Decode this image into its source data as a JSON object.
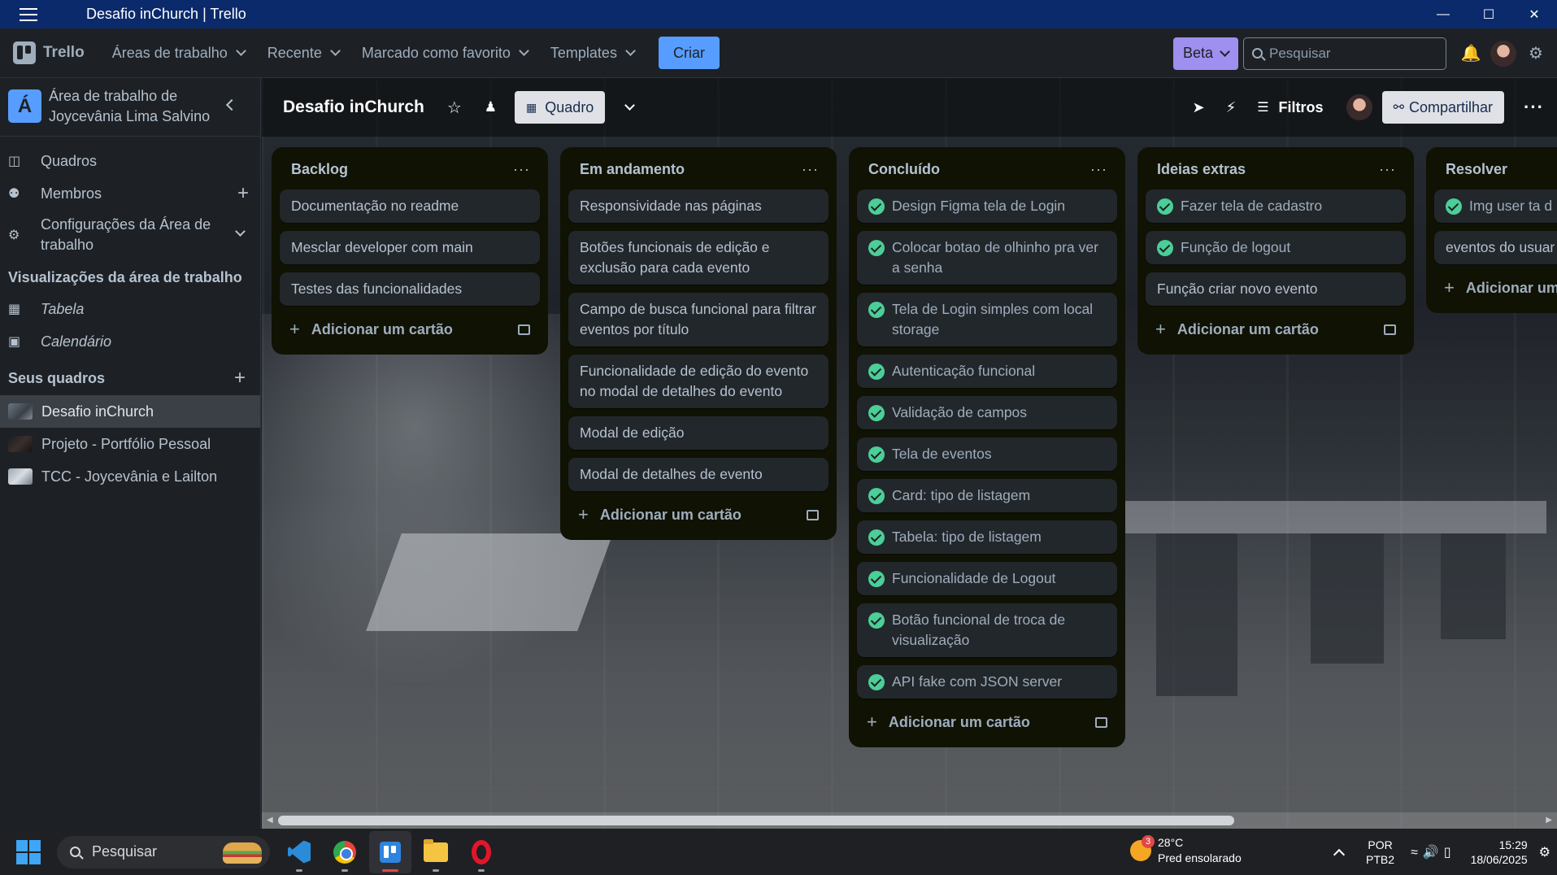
{
  "window": {
    "title": "Desafio inChurch | Trello",
    "controls": [
      "—",
      "☐",
      "✕"
    ]
  },
  "header": {
    "logo_text": "Trello",
    "nav": [
      {
        "label": "Áreas de trabalho"
      },
      {
        "label": "Recente"
      },
      {
        "label": "Marcado como favorito"
      },
      {
        "label": "Templates"
      }
    ],
    "create_label": "Criar",
    "beta_label": "Beta",
    "search_placeholder": "Pesquisar",
    "accent_color": "#579dff",
    "beta_color": "#9f8fef"
  },
  "sidebar": {
    "workspace_initial": "Á",
    "workspace_name_line1": "Área de trabalho de",
    "workspace_name_line2": "Joycevânia Lima Salvino",
    "items": [
      {
        "label": "Quadros",
        "icon": "board-icon"
      },
      {
        "label": "Membros",
        "icon": "person-icon"
      },
      {
        "label_line1": "Configurações da Área de",
        "label_line2": "trabalho",
        "icon": "gear-icon"
      }
    ],
    "views_heading": "Visualizações da área de trabalho",
    "views": [
      {
        "label": "Tabela",
        "icon": "table-icon"
      },
      {
        "label": "Calendário",
        "icon": "calendar-icon"
      }
    ],
    "boards_heading": "Seus quadros",
    "boards": [
      {
        "label": "Desafio inChurch",
        "active": true
      },
      {
        "label": "Projeto - Portfólio Pessoal",
        "active": false
      },
      {
        "label": "TCC - Joycevânia e Lailton",
        "active": false
      }
    ]
  },
  "board": {
    "title": "Desafio inChurch",
    "view_label": "Quadro",
    "filters_label": "Filtros",
    "share_label": "Compartilhar",
    "add_card_label": "Adicionar um cartão",
    "add_card_label_partial": "Adicionar um",
    "lists": [
      {
        "title": "Backlog",
        "cards": [
          {
            "text": "Documentação no readme",
            "done": false
          },
          {
            "text": "Mesclar developer com main",
            "done": false
          },
          {
            "text": "Testes das funcionalidades",
            "done": false
          }
        ]
      },
      {
        "title": "Em andamento",
        "cards": [
          {
            "text": "Responsividade nas páginas",
            "done": false
          },
          {
            "text": "Botões funcionais de edição e exclusão para cada evento",
            "done": false
          },
          {
            "text": "Campo de busca funcional para filtrar eventos por título",
            "done": false
          },
          {
            "text": "Funcionalidade de edição do evento no modal de detalhes do evento",
            "done": false
          },
          {
            "text": "Modal de edição",
            "done": false
          },
          {
            "text": "Modal de detalhes de evento",
            "done": false
          }
        ]
      },
      {
        "title": "Concluído",
        "cards": [
          {
            "text": "Design Figma tela de Login",
            "done": true
          },
          {
            "text": "Colocar botao de olhinho pra ver a senha",
            "done": true
          },
          {
            "text": "Tela de Login simples com local storage",
            "done": true
          },
          {
            "text": "Autenticação funcional",
            "done": true
          },
          {
            "text": "Validação de campos",
            "done": true
          },
          {
            "text": "Tela de eventos",
            "done": true
          },
          {
            "text": "Card: tipo de listagem",
            "done": true
          },
          {
            "text": "Tabela: tipo de listagem",
            "done": true
          },
          {
            "text": "Funcionalidade de Logout",
            "done": true
          },
          {
            "text": "Botão funcional de troca de visualização",
            "done": true
          },
          {
            "text": "API fake com JSON server",
            "done": true
          }
        ]
      },
      {
        "title": "Ideias extras",
        "cards": [
          {
            "text": "Fazer tela de cadastro",
            "done": true
          },
          {
            "text": "Função de logout",
            "done": true
          },
          {
            "text": "Função criar novo evento",
            "done": false
          }
        ]
      },
      {
        "title": "Resolver",
        "cards": [
          {
            "text": "Img user ta d",
            "done": true
          },
          {
            "text": "eventos do usuar",
            "done": false
          }
        ]
      }
    ]
  },
  "taskbar": {
    "search_label": "Pesquisar",
    "weather_badge": "3",
    "weather_temp": "28°C",
    "weather_desc": "Pred ensolarado",
    "lang_line1": "POR",
    "lang_line2": "PTB2",
    "time": "15:29",
    "date": "18/06/2025"
  }
}
